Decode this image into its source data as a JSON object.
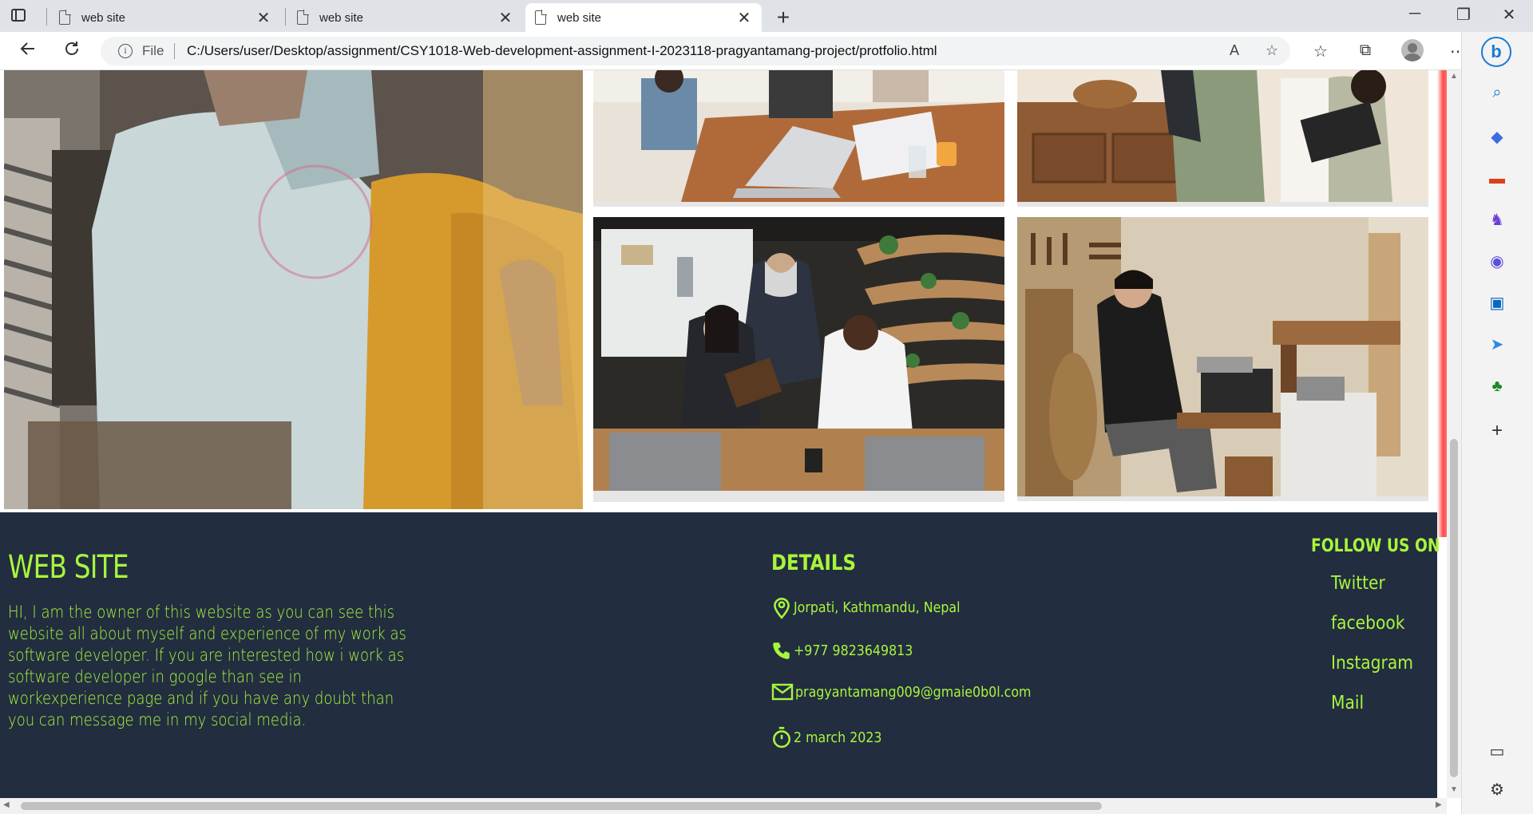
{
  "browser": {
    "tabs": [
      {
        "title": "web site",
        "active": false
      },
      {
        "title": "web site",
        "active": false
      },
      {
        "title": "web site",
        "active": true
      }
    ],
    "address": {
      "scheme_label": "File",
      "url": "C:/Users/user/Desktop/assignment/CSY1018-Web-development-assignment-I-2023118-pragyantamang-project/protfolio.html"
    }
  },
  "footer": {
    "site_title": "WEB SITE",
    "about": "HI, I am the owner of this website as you can see this website all about myself and experience of my work as software developer. If you are interested how i work as software developer in google than see in workexperience page and if you have any doubt than you can message me in my social media.",
    "details_title": "DETAILS",
    "details": {
      "address": "Jorpati, Kathmandu, Nepal",
      "phone": "+977 9823649813",
      "email": "pragyantamang009@gmaie0b0l.com",
      "date": "2 march 2023"
    },
    "follow_title": "FOLLOW US ON",
    "social": {
      "twitter": "Twitter",
      "facebook": "facebook",
      "instagram": "Instagram",
      "mail": "Mail"
    }
  },
  "colors": {
    "footer_bg": "#222d40",
    "footer_text": "#a8f53b"
  }
}
